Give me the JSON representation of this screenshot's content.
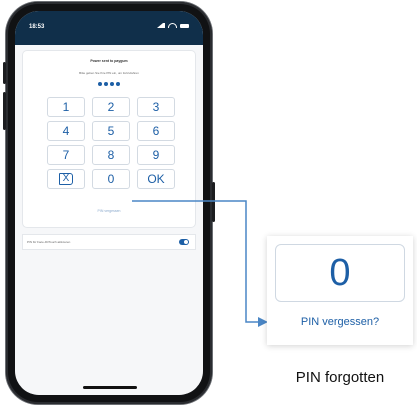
{
  "status_bar": {
    "time": "18:53"
  },
  "pin_screen": {
    "title": "Power sent to paygum",
    "description": "Bitte geben Sie Ihre PIN ein, um fortzufahren",
    "dots": [
      "•",
      "•",
      "•",
      "•"
    ],
    "keys": [
      "1",
      "2",
      "3",
      "4",
      "5",
      "6",
      "7",
      "8",
      "9",
      "X",
      "0",
      "OK"
    ],
    "forgot_link": "PIN vergessen",
    "setting_label": "PIN für Face-ID/Touch aktivieren",
    "setting_enabled": true
  },
  "callout": {
    "zoom_key": "0",
    "zoom_link": "PIN vergessen?",
    "caption": "PIN forgotten"
  },
  "colors": {
    "accent": "#1d5fa6",
    "status_bar": "#102f4a",
    "connector": "#4a86c5"
  }
}
